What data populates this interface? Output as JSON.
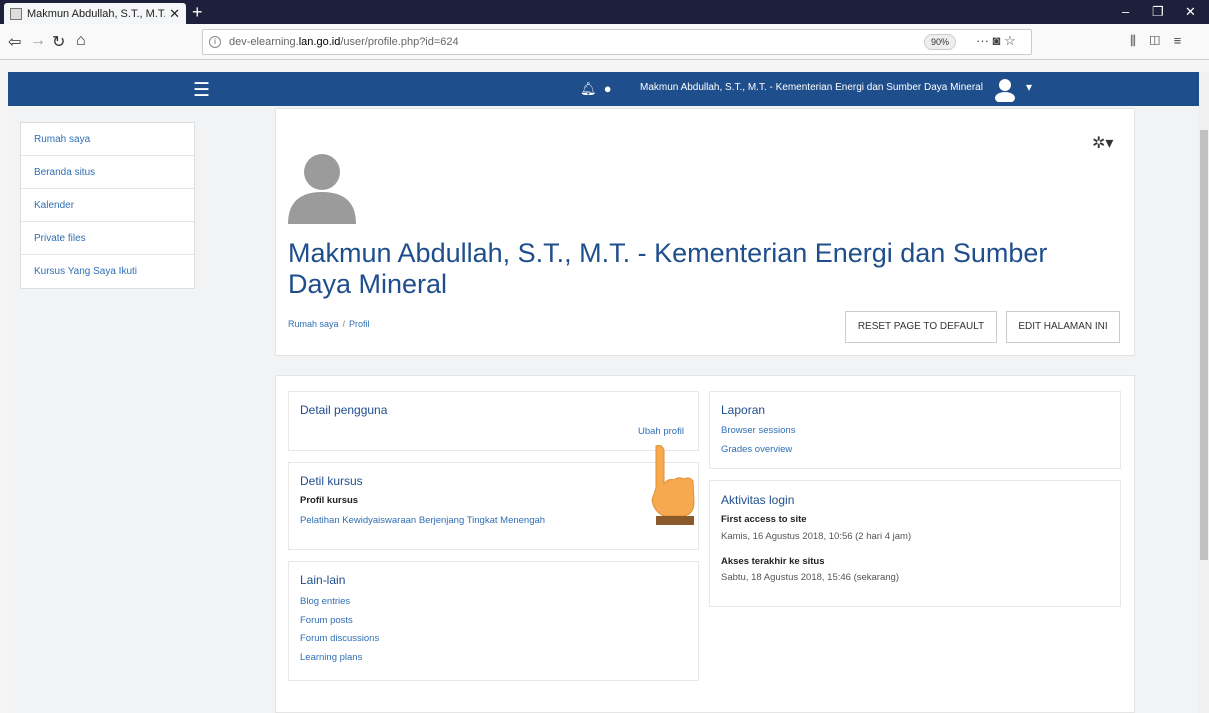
{
  "browser": {
    "tab_title": "Makmun Abdullah, S.T., M.T. - K",
    "url_prefix": "dev-elearning.",
    "url_domain": "lan.go.id",
    "url_path": "/user/profile.php?id=624",
    "zoom": "90%",
    "newtab_symbol": "+"
  },
  "header": {
    "username": "Makmun Abdullah, S.T., M.T. - Kementerian Energi dan Sumber Daya Mineral"
  },
  "sidebar": {
    "items": [
      {
        "label": "Rumah saya"
      },
      {
        "label": "Beranda situs"
      },
      {
        "label": "Kalender"
      },
      {
        "label": "Private files"
      },
      {
        "label": "Kursus Yang Saya Ikuti"
      }
    ]
  },
  "profile": {
    "title": "Makmun Abdullah, S.T., M.T. - Kementerian Energi dan Sumber Daya Mineral",
    "breadcrumb": [
      "Rumah saya",
      "Profil"
    ],
    "reset_button": "RESET PAGE TO DEFAULT",
    "edit_button": "EDIT HALAMAN INI"
  },
  "detail_pengguna": {
    "title": "Detail pengguna",
    "edit_link": "Ubah profil"
  },
  "detil_kursus": {
    "title": "Detil kursus",
    "profile_label": "Profil kursus",
    "course": "Pelatihan Kewidyaiswaraan Berjenjang Tingkat Menengah"
  },
  "lain_lain": {
    "title": "Lain-lain",
    "links": [
      "Blog entries",
      "Forum posts",
      "Forum discussions",
      "Learning plans"
    ]
  },
  "laporan": {
    "title": "Laporan",
    "links": [
      "Browser sessions",
      "Grades overview"
    ]
  },
  "aktivitas_login": {
    "title": "Aktivitas login",
    "first_access_label": "First access to site",
    "first_access_value": "Kamis, 16 Agustus 2018, 10:56  (2 hari 4 jam)",
    "last_access_label": "Akses terakhir ke situs",
    "last_access_value": "Sabtu, 18 Agustus 2018, 15:46  (sekarang)"
  }
}
